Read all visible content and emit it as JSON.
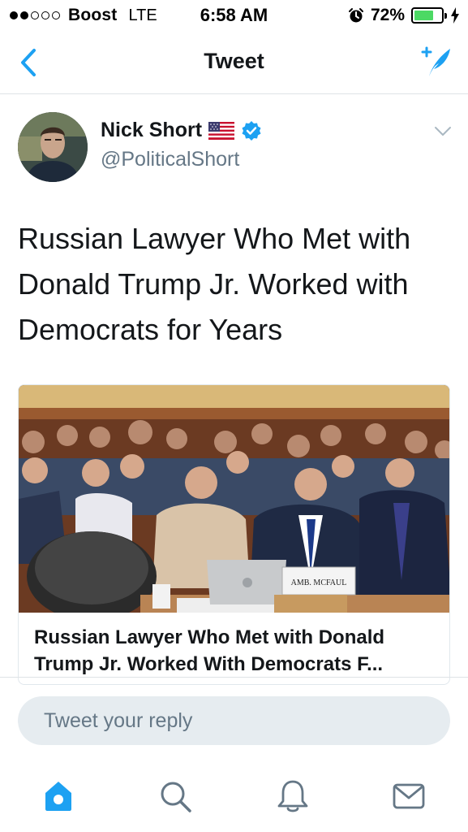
{
  "status_bar": {
    "carrier": "Boost",
    "network": "LTE",
    "time": "6:58 AM",
    "battery": "72%",
    "battery_level": 0.72,
    "signal_bars_filled": 2,
    "signal_bars_total": 5
  },
  "nav": {
    "title": "Tweet",
    "back_icon": "chevron-left-icon",
    "compose_icon": "compose-tweet-icon"
  },
  "tweet": {
    "author_name": "Nick Short",
    "author_handle": "@PoliticalShort",
    "verified": true,
    "text_lines": [
      "Russian Lawyer Who Met with",
      "Donald Trump Jr. Worked with",
      "Democrats for Years"
    ]
  },
  "card": {
    "nameplate": "AMB. MCFAUL",
    "title_lines": [
      "Russian Lawyer Who Met with Donald",
      "Trump Jr. Worked With Democrats F..."
    ]
  },
  "reply": {
    "placeholder": "Tweet your reply"
  },
  "tab_bar": {
    "items": [
      "home-icon",
      "search-icon",
      "notifications-icon",
      "messages-icon"
    ],
    "active": "home-icon"
  },
  "colors": {
    "accent": "#1da1f2",
    "text": "#14171a",
    "secondary_text": "#657786",
    "battery": "#4cd964"
  }
}
